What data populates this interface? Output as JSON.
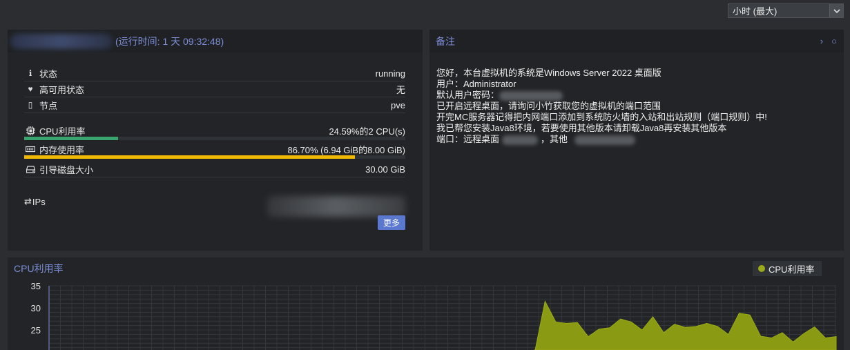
{
  "timeframe": {
    "selected": "小时 (最大)"
  },
  "status": {
    "uptime": "(运行时间: 1 天 09:32:48)",
    "rows": [
      {
        "icon": "info-icon",
        "glyph": "ℹ",
        "label": "状态",
        "value": "running"
      },
      {
        "icon": "heartbeat-icon",
        "glyph": "♥",
        "label": "高可用状态",
        "value": "无"
      },
      {
        "icon": "server-icon",
        "glyph": "▯",
        "label": "节点",
        "value": "pve"
      }
    ],
    "cpu": {
      "label": "CPU利用率",
      "value": "24.59%的2 CPU(s)",
      "percent": 24.59,
      "color": "#3aa46e"
    },
    "memory": {
      "label": "内存使用率",
      "value": "86.70% (6.94 GiB的8.00 GiB)",
      "percent": 86.7,
      "color": "#f0b800"
    },
    "disk": {
      "label": "引导磁盘大小",
      "value": "30.00 GiB"
    },
    "ips": {
      "label": "IPs"
    },
    "more_label": "更多"
  },
  "notes": {
    "title": "备注",
    "lines": {
      "l1": "您好，本台虚拟机的系统是Windows Server 2022 桌面版",
      "l2": "用户：Administrator",
      "l3": "默认用户密码：",
      "l4": "已开启远程桌面，请询问小竹获取您的虚拟机的端口范围",
      "l5": "开完MC服务器记得把内网端口添加到系统防火墙的入站和出站规则（端口规则）中!",
      "l6": "我已帮您安装Java8环境，若要使用其他版本请卸载Java8再安装其他版本",
      "l7a": "端口：远程桌面",
      "l7b": "，其他"
    }
  },
  "chart_data": {
    "type": "area",
    "title": "CPU利用率",
    "ylabel": "",
    "legend": [
      "CPU利用率"
    ],
    "legend_position": "top-right",
    "ylim": [
      20,
      35
    ],
    "yticks": [
      35,
      30,
      25
    ],
    "grid": true,
    "color": "#8a9a12",
    "series": [
      {
        "name": "CPU利用率",
        "values": [
          null,
          null,
          null,
          null,
          null,
          null,
          null,
          null,
          null,
          null,
          null,
          null,
          null,
          null,
          null,
          null,
          null,
          null,
          null,
          null,
          null,
          null,
          null,
          null,
          null,
          null,
          null,
          null,
          null,
          null,
          null,
          null,
          null,
          null,
          null,
          null,
          null,
          null,
          null,
          null,
          null,
          null,
          null,
          null,
          null,
          19.5,
          31.5,
          26.8,
          26.5,
          26.7,
          23.5,
          25.2,
          25.5,
          27.5,
          26.8,
          25.0,
          28.0,
          24.4,
          26.3,
          25.6,
          25.8,
          26.5,
          25.8,
          24.0,
          28.8,
          28.4,
          23.6,
          23.2,
          24.4,
          22.3,
          24.2,
          25.7,
          23.2,
          23.5
        ]
      }
    ]
  }
}
